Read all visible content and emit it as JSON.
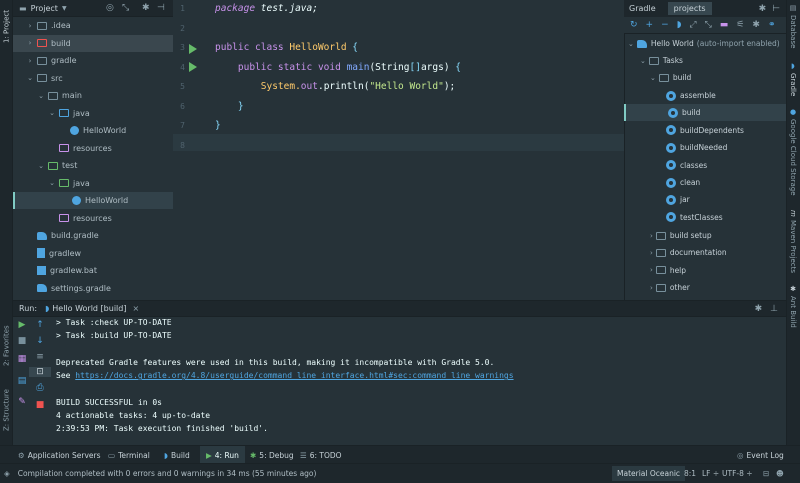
{
  "left_stripe": {
    "project_tab": "1: Project",
    "favorites_tab": "2: Favorites",
    "structure_tab": "Z: Structure"
  },
  "right_stripe": {
    "database": "Database",
    "gradle": "Gradle",
    "cloud": "Google Cloud Storage",
    "maven": "Maven Projects",
    "ant": "Ant Build"
  },
  "project_panel": {
    "title": "Project",
    "tree": [
      {
        "label": ".idea",
        "indent": 1,
        "icon": "folder-gray",
        "chevron": "›"
      },
      {
        "label": "build",
        "indent": 1,
        "icon": "folder-red",
        "chevron": "›",
        "selected": true
      },
      {
        "label": "gradle",
        "indent": 1,
        "icon": "folder-gray",
        "chevron": "›"
      },
      {
        "label": "src",
        "indent": 1,
        "icon": "folder-gray",
        "chevron": "⌄"
      },
      {
        "label": "main",
        "indent": 2,
        "icon": "folder-gray",
        "chevron": "⌄"
      },
      {
        "label": "java",
        "indent": 3,
        "icon": "folder-blue",
        "chevron": "⌄"
      },
      {
        "label": "HelloWorld",
        "indent": 4,
        "icon": "class",
        "chevron": ""
      },
      {
        "label": "resources",
        "indent": 3,
        "icon": "folder-purple",
        "chevron": ""
      },
      {
        "label": "test",
        "indent": 2,
        "icon": "folder-green",
        "chevron": "⌄"
      },
      {
        "label": "java",
        "indent": 3,
        "icon": "folder-green",
        "chevron": "⌄"
      },
      {
        "label": "HelloWorld",
        "indent": 4,
        "icon": "class",
        "chevron": "",
        "selected2": true
      },
      {
        "label": "resources",
        "indent": 3,
        "icon": "folder-purple",
        "chevron": ""
      },
      {
        "label": "build.gradle",
        "indent": 1,
        "icon": "gradle",
        "chevron": ""
      },
      {
        "label": "gradlew",
        "indent": 1,
        "icon": "file",
        "chevron": ""
      },
      {
        "label": "gradlew.bat",
        "indent": 1,
        "icon": "win",
        "chevron": ""
      },
      {
        "label": "settings.gradle",
        "indent": 1,
        "icon": "gradle",
        "chevron": ""
      }
    ]
  },
  "editor": {
    "lines": [
      {
        "n": "1",
        "parts": [
          [
            "package ",
            "#c792ea"
          ],
          [
            "test.java;",
            "#eeffff"
          ]
        ],
        "italic": true
      },
      {
        "n": "2",
        "parts": []
      },
      {
        "n": "3",
        "parts": [
          [
            "public class ",
            "#c792ea"
          ],
          [
            "HelloWorld ",
            "#ffcb6b"
          ],
          [
            "{",
            "#89ddff"
          ]
        ]
      },
      {
        "n": "4",
        "parts": [
          [
            "    public static void ",
            "#c792ea"
          ],
          [
            "main",
            "#82aaff"
          ],
          [
            "(String",
            "#eeffff"
          ],
          [
            "[]",
            "#89ddff"
          ],
          [
            "args) ",
            "#eeffff"
          ],
          [
            "{",
            "#89ddff"
          ]
        ]
      },
      {
        "n": "5",
        "parts": [
          [
            "        System.",
            "#ffcb6b"
          ],
          [
            "out",
            "#c792ea"
          ],
          [
            ".println(",
            "#eeffff"
          ],
          [
            "\"Hello World\"",
            "#c3e88d"
          ],
          [
            ");",
            "#eeffff"
          ]
        ]
      },
      {
        "n": "6",
        "parts": [
          [
            "    }",
            "#89ddff"
          ]
        ]
      },
      {
        "n": "7",
        "parts": [
          [
            "}",
            "#89ddff"
          ]
        ]
      },
      {
        "n": "8",
        "parts": []
      }
    ]
  },
  "gradle_panel": {
    "tab1": "Gradle",
    "tab2": "projects",
    "root": "Hello World",
    "root_note": "(auto-import enabled)",
    "tasks": "Tasks",
    "build_group": "build",
    "items": [
      "assemble",
      "build",
      "buildDependents",
      "buildNeeded",
      "classes",
      "clean",
      "jar",
      "testClasses"
    ],
    "groups": [
      "build setup",
      "documentation",
      "help",
      "other"
    ]
  },
  "run_bar": {
    "label": "Run:",
    "config": "Hello World [build]"
  },
  "console": {
    "lines": [
      {
        "text": "> Task :check UP-TO-DATE",
        "type": "normal"
      },
      {
        "text": "> Task :build UP-TO-DATE",
        "type": "normal"
      },
      {
        "text": "",
        "type": "normal"
      },
      {
        "text": "Deprecated Gradle features were used in this build, making it incompatible with Gradle 5.0.",
        "type": "normal"
      },
      {
        "text_prefix": "See ",
        "link": "https://docs.gradle.org/4.8/userguide/command_line_interface.html#sec:command_line_warnings",
        "type": "link"
      },
      {
        "text": "",
        "type": "normal"
      },
      {
        "text": "BUILD SUCCESSFUL in 0s",
        "type": "normal"
      },
      {
        "text": "4 actionable tasks: 4 up-to-date",
        "type": "normal"
      },
      {
        "text": "2:39:53 PM: Task execution finished 'build'.",
        "type": "normal"
      }
    ]
  },
  "bottom_tabs": {
    "app_servers": "Application Servers",
    "terminal": "Terminal",
    "build": "Build",
    "run": "4: Run",
    "debug": "5: Debug",
    "todo": "6: TODO",
    "event_log": "Event Log"
  },
  "status_bar": {
    "message": "Compilation completed with 0 errors and 0 warnings in 34 ms (55 minutes ago)",
    "theme": "Material Oceanic",
    "position": "8:1",
    "line_sep": "LF ÷",
    "encoding": "UTF-8 ÷"
  },
  "colors": {
    "accent": "#80cbc4",
    "gradle_blue": "#4fa5e0",
    "run_green": "#66bb6a"
  }
}
